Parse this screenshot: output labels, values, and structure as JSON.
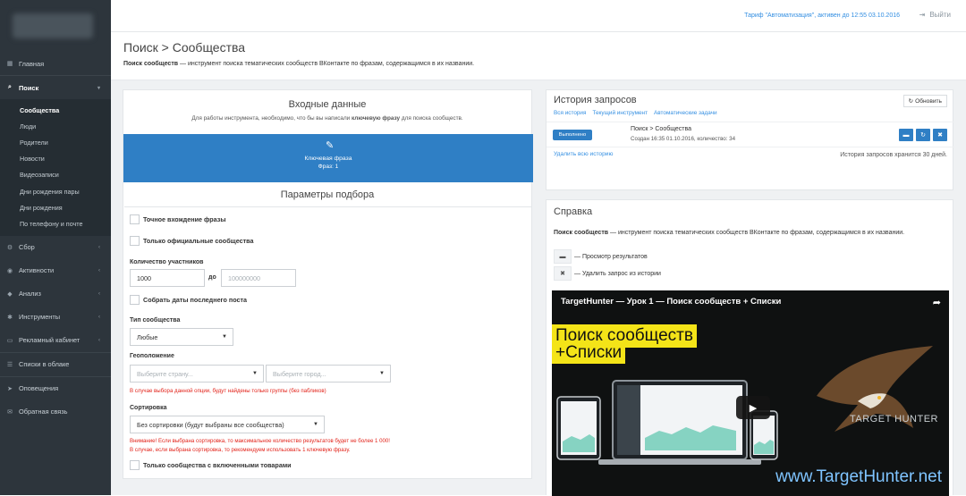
{
  "sidebar": {
    "items": [
      {
        "icon": "grid-icon",
        "glyph": "▦",
        "label": "Главная"
      },
      {
        "icon": "search-icon",
        "glyph": "⌕",
        "label": "Поиск",
        "chevron": "▾"
      },
      {
        "icon": "cog-icon",
        "glyph": "⚙",
        "label": "Сбор",
        "chevron": "‹"
      },
      {
        "icon": "eye-icon",
        "glyph": "◉",
        "label": "Активности",
        "chevron": "‹"
      },
      {
        "icon": "diamond-icon",
        "glyph": "◆",
        "label": "Анализ",
        "chevron": "‹"
      },
      {
        "icon": "gear-icon",
        "glyph": "✱",
        "label": "Инструменты",
        "chevron": "‹"
      },
      {
        "icon": "monitor-icon",
        "glyph": "▭",
        "label": "Рекламный кабинет",
        "chevron": "‹"
      },
      {
        "icon": "cloud-list-icon",
        "glyph": "☰",
        "label": "Списки в облаке"
      },
      {
        "icon": "send-icon",
        "glyph": "➤",
        "label": "Оповещения"
      },
      {
        "icon": "envelope-icon",
        "glyph": "✉",
        "label": "Обратная связь"
      }
    ],
    "search_sub": [
      "Сообщества",
      "Люди",
      "Родители",
      "Новости",
      "Видеозаписи",
      "Дни рождения пары",
      "Дни рождения",
      "По телефону и почте"
    ]
  },
  "topbar": {
    "tariff": "Тариф \"Автоматизация\", активен до 12:55 03.10.2016",
    "logout": "Выйти",
    "logout_icon": "⇥"
  },
  "page": {
    "title": "Поиск > Сообщества",
    "desc_bold": "Поиск сообществ",
    "desc_rest": " — инструмент поиска тематических сообществ ВКонтакте по фразам, содержащимся в их названии."
  },
  "input": {
    "title": "Входные данные",
    "hint_pre": "Для работы инструмента, необходимо, что бы вы написали ",
    "hint_bold": "ключевую фразу",
    "hint_post": " для поиска сообществ.",
    "button_line1": "Ключевая фраза",
    "button_line2": "Фраз: 1",
    "button_icon": "✎"
  },
  "params": {
    "title": "Параметры подбора",
    "exact": "Точное вхождение фразы",
    "official": "Только официальные сообщества",
    "members_label": "Количество участников",
    "members_from": "1000",
    "members_to_sep": "до",
    "members_to_placeholder": "100000000",
    "collect_dates": "Собрать даты последнего поста",
    "type_label": "Тип сообщества",
    "type_value": "Любые",
    "geo_label": "Геоположение",
    "country_placeholder": "Выберите страну...",
    "city_placeholder": "Выберите город...",
    "geo_warning": "В случае выбора данной опции, будут найдены только группы (без пабликов)",
    "sort_label": "Сортировка",
    "sort_value": "Без сортировки (будут выбраны все сообщества)",
    "sort_warning1": "Внимание! Если выбрана сортировка, то максимальное количество результатов будет не более 1 000!",
    "sort_warning2": "В случае, если выбрана сортировка, то рекомендуем использовать 1 ключевую фразу.",
    "goods_only": "Только сообщества с включенными товарами"
  },
  "history": {
    "title": "История запросов",
    "refresh": "Обновить",
    "tabs": [
      "Вся история",
      "Текущий инструмент",
      "Автоматические задачи"
    ],
    "row": {
      "status": "Выполнено",
      "name": "Поиск > Сообщества",
      "meta": "Создан 16:35 01.10.2016, количество: 34"
    },
    "delete_all": "Удалить всю историю",
    "keep_note": "История запросов хранится 30 дней."
  },
  "help": {
    "title": "Справка",
    "desc_bold": "Поиск сообществ",
    "desc_rest": " — инструмент поиска тематических сообществ ВКонтакте по фразам, содержащимся в их названии.",
    "legend_view": "— Просмотр результатов",
    "legend_delete": "— Удалить запрос из истории"
  },
  "video": {
    "title": "TargetHunter — Урок 1 — Поиск сообществ + Списки",
    "banner1": "Поиск сообществ",
    "banner2": "+Списки",
    "logo": "TARGET HUNTER",
    "url": "www.TargetHunter.net"
  },
  "colors": {
    "sidebar": "#2d353c",
    "accent": "#2f7fc5",
    "link": "#348fe2",
    "warning": "#e2231a",
    "banner": "#f4e418"
  }
}
